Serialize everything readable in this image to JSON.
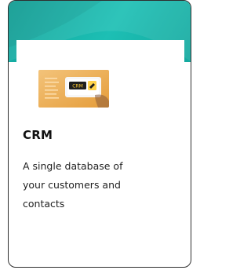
{
  "card": {
    "title": "CRM",
    "description_lines": [
      "A single database of",
      "your customers and",
      "contacts"
    ],
    "thumbnail": {
      "icon": "crm-thumbnail-icon",
      "label": "CRM"
    }
  },
  "colors": {
    "banner": "#1dbfb4",
    "border": "#2f2f2f"
  }
}
